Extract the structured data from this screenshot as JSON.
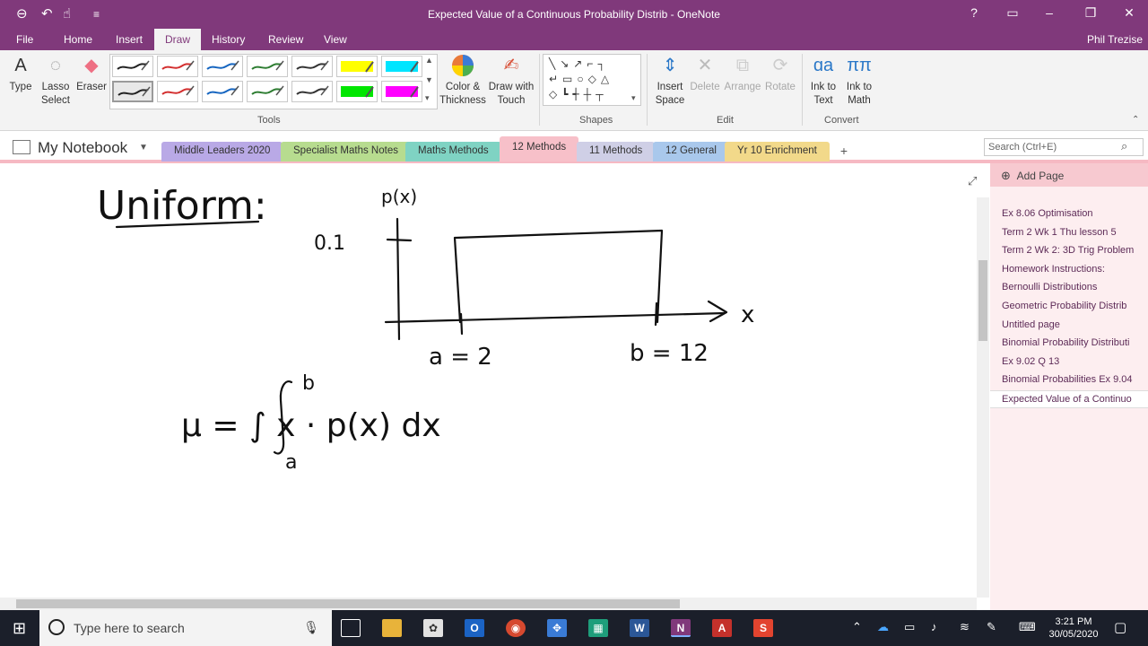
{
  "window": {
    "title": "Expected Value of a Continuous Probability Distrib - OneNote",
    "help": "?",
    "minimize": "–",
    "maximize": "❐",
    "close": "✕"
  },
  "menu_tabs": [
    "File",
    "Home",
    "Insert",
    "Draw",
    "History",
    "Review",
    "View"
  ],
  "active_tab": "Draw",
  "user_name": "Phil Trezise",
  "ribbon": {
    "type": "Type",
    "lasso": "Lasso Select",
    "eraser": "Eraser",
    "color_thickness": "Color & Thickness",
    "draw_touch": "Draw with Touch",
    "insert_space": "Insert Space",
    "delete": "Delete",
    "arrange": "Arrange",
    "rotate": "Rotate",
    "ink_text": "Ink to Text",
    "ink_math": "Ink to Math",
    "groups": {
      "tools": "Tools",
      "shapes": "Shapes",
      "edit": "Edit",
      "convert": "Convert"
    },
    "pens": [
      "#222222",
      "#d32f2f",
      "#1565c0",
      "#2e7d32",
      "#333333",
      "#ffff00",
      "#00e5ff",
      "#222222",
      "#d32f2f",
      "#1565c0",
      "#2e7d32",
      "#333333",
      "#00e600",
      "#ff00ff"
    ]
  },
  "notebook": {
    "name": "My Notebook",
    "sections": [
      {
        "label": "Middle Leaders 2020",
        "color": "#b9a9e6"
      },
      {
        "label": "Specialist Maths Notes",
        "color": "#b7dc8f"
      },
      {
        "label": "Maths Methods",
        "color": "#7fd3c3"
      },
      {
        "label": "12 Methods",
        "color": "#f7c0c9"
      },
      {
        "label": "11 Methods",
        "color": "#cfcfe6"
      },
      {
        "label": "12 General",
        "color": "#a9c8ec"
      },
      {
        "label": "Yr 10 Enrichment",
        "color": "#f2d98a"
      }
    ],
    "add_section": "+",
    "search_placeholder": "Search (Ctrl+E)"
  },
  "pages": {
    "add_page": "Add Page",
    "items": [
      "Ex 8.06 Optimisation",
      "Term 2 Wk 1 Thu lesson 5",
      "Term 2 Wk 2: 3D Trig Problem",
      "Homework Instructions:",
      "Bernoulli Distributions",
      "Geometric Probability Distrib",
      "Untitled page",
      "Binomial Probability Distributi",
      "Ex 9.02 Q 13",
      "Binomial Probabilities Ex 9.04",
      "Expected Value of a Continuo"
    ],
    "active_index": 10
  },
  "ink": {
    "heading": "Uniform:",
    "y_axis_label": "p(x)",
    "y_tick": "0.1",
    "x_axis_label": "x",
    "a_label": "a = 2",
    "b_label": "b = 12",
    "formula": "μ = ∫ x · p(x) dx",
    "upper_limit": "b",
    "lower_limit": "a"
  },
  "taskbar": {
    "search_placeholder": "Type here to search",
    "time": "3:21 PM",
    "date": "30/05/2020"
  }
}
